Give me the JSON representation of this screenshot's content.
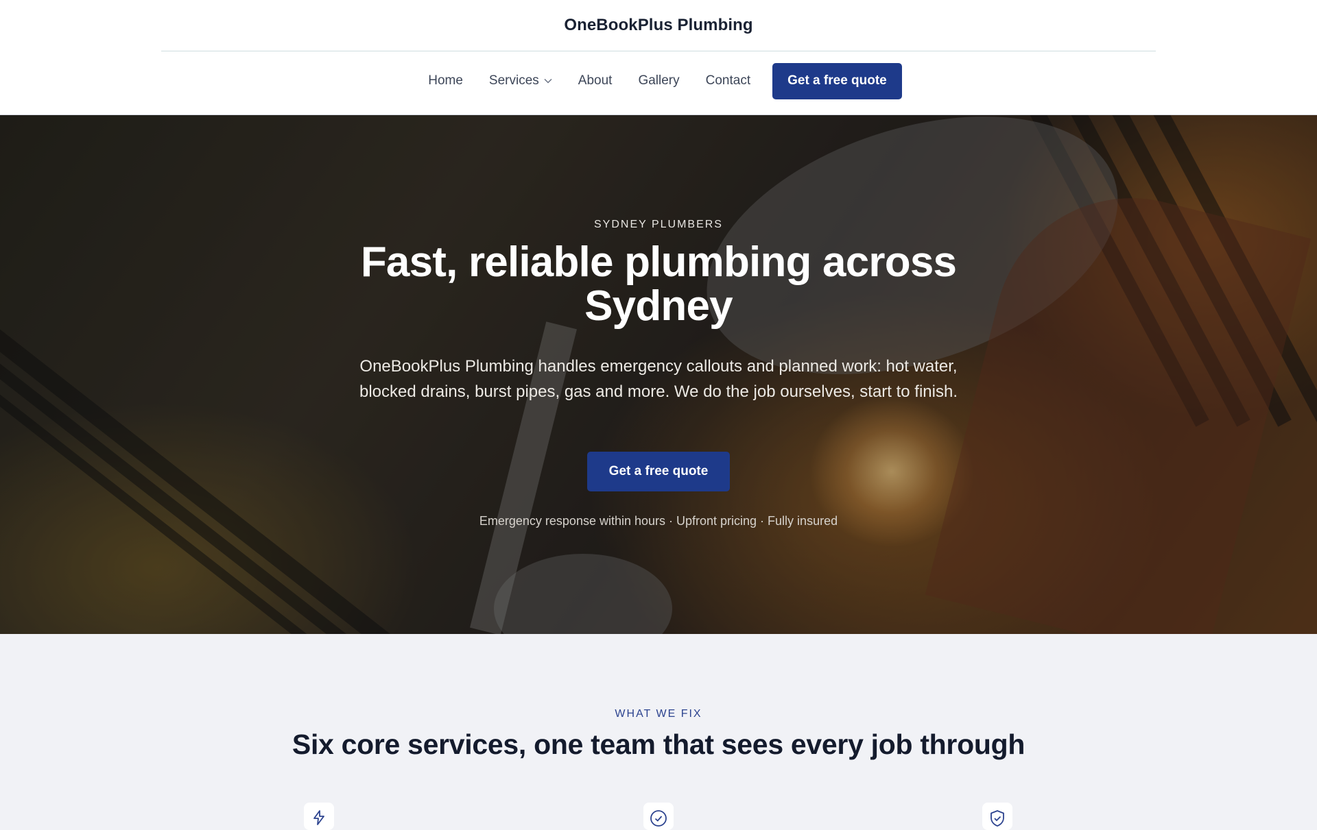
{
  "header": {
    "brand": "OneBookPlus Plumbing",
    "nav": [
      {
        "label": "Home"
      },
      {
        "label": "Services",
        "has_dropdown": true,
        "icon": "chevron-down-icon"
      },
      {
        "label": "About"
      },
      {
        "label": "Gallery"
      },
      {
        "label": "Contact"
      }
    ],
    "cta_label": "Get a free quote"
  },
  "hero": {
    "eyebrow": "SYDNEY PLUMBERS",
    "title": "Fast, reliable plumbing across Sydney",
    "lede": "OneBookPlus Plumbing handles emergency callouts and planned work: hot water, blocked drains, burst pipes, gas and more. We do the job ourselves, start to finish.",
    "cta_label": "Get a free quote",
    "trust_line": "Emergency response within hours · Upfront pricing · Fully insured",
    "background_image": "plumber gloved hands tightening pipe fitting with wrench"
  },
  "services_section": {
    "eyebrow": "WHAT WE FIX",
    "title": "Six core services, one team that sees every job through",
    "icons": [
      "lightning-icon",
      "check-circle-icon",
      "shield-check-icon"
    ]
  },
  "colors": {
    "accent": "#1e3a8a",
    "section_bg": "#f1f2f6",
    "header_bg": "#ffffff",
    "eyebrow_blue": "#2c438f",
    "heading": "#141b2d"
  }
}
